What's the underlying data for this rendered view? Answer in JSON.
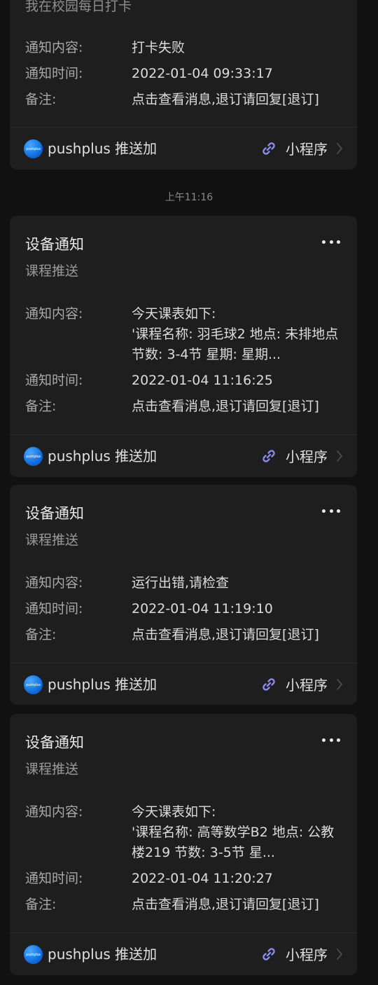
{
  "cards": [
    {
      "subtitle": "我在校园每日打卡",
      "content_label": "通知内容:",
      "content": "打卡失败",
      "time_label": "通知时间:",
      "time": "2022-01-04 09:33:17",
      "remark_label": "备注:",
      "remark": "点击查看消息,退订请回复[退订]"
    },
    {
      "title": "设备通知",
      "subtitle": "课程推送",
      "content_label": "通知内容:",
      "content": "今天课表如下:\n'课程名称: 羽毛球2 地点: 未排地点 节数: 3-4节 星期: 星期...",
      "time_label": "通知时间:",
      "time": "2022-01-04 11:16:25",
      "remark_label": "备注:",
      "remark": "点击查看消息,退订请回复[退订]"
    },
    {
      "title": "设备通知",
      "subtitle": "课程推送",
      "content_label": "通知内容:",
      "content": "运行出错,请检查",
      "time_label": "通知时间:",
      "time": "2022-01-04 11:19:10",
      "remark_label": "备注:",
      "remark": "点击查看消息,退订请回复[退订]"
    },
    {
      "title": "设备通知",
      "subtitle": "课程推送",
      "content_label": "通知内容:",
      "content": "今天课表如下:\n'课程名称: 高等数学B2 地点: 公教楼219 节数: 3-5节 星...",
      "time_label": "通知时间:",
      "time": "2022-01-04 11:20:27",
      "remark_label": "备注:",
      "remark": "点击查看消息,退订请回复[退订]"
    }
  ],
  "timestamp": "上午11:16",
  "footer": {
    "brand_logo_text": "pushplus",
    "brand_name": "pushplus 推送加",
    "mini_program_label": "小程序",
    "mini_program_icon": "link-icon",
    "chevron_icon": "chevron-right-icon",
    "more_icon": "more-dots-icon"
  },
  "colors": {
    "background": "#111111",
    "card": "#1e1e1e",
    "brand_blue": "#0a64d8",
    "link_icon": "#8b8bf0"
  }
}
